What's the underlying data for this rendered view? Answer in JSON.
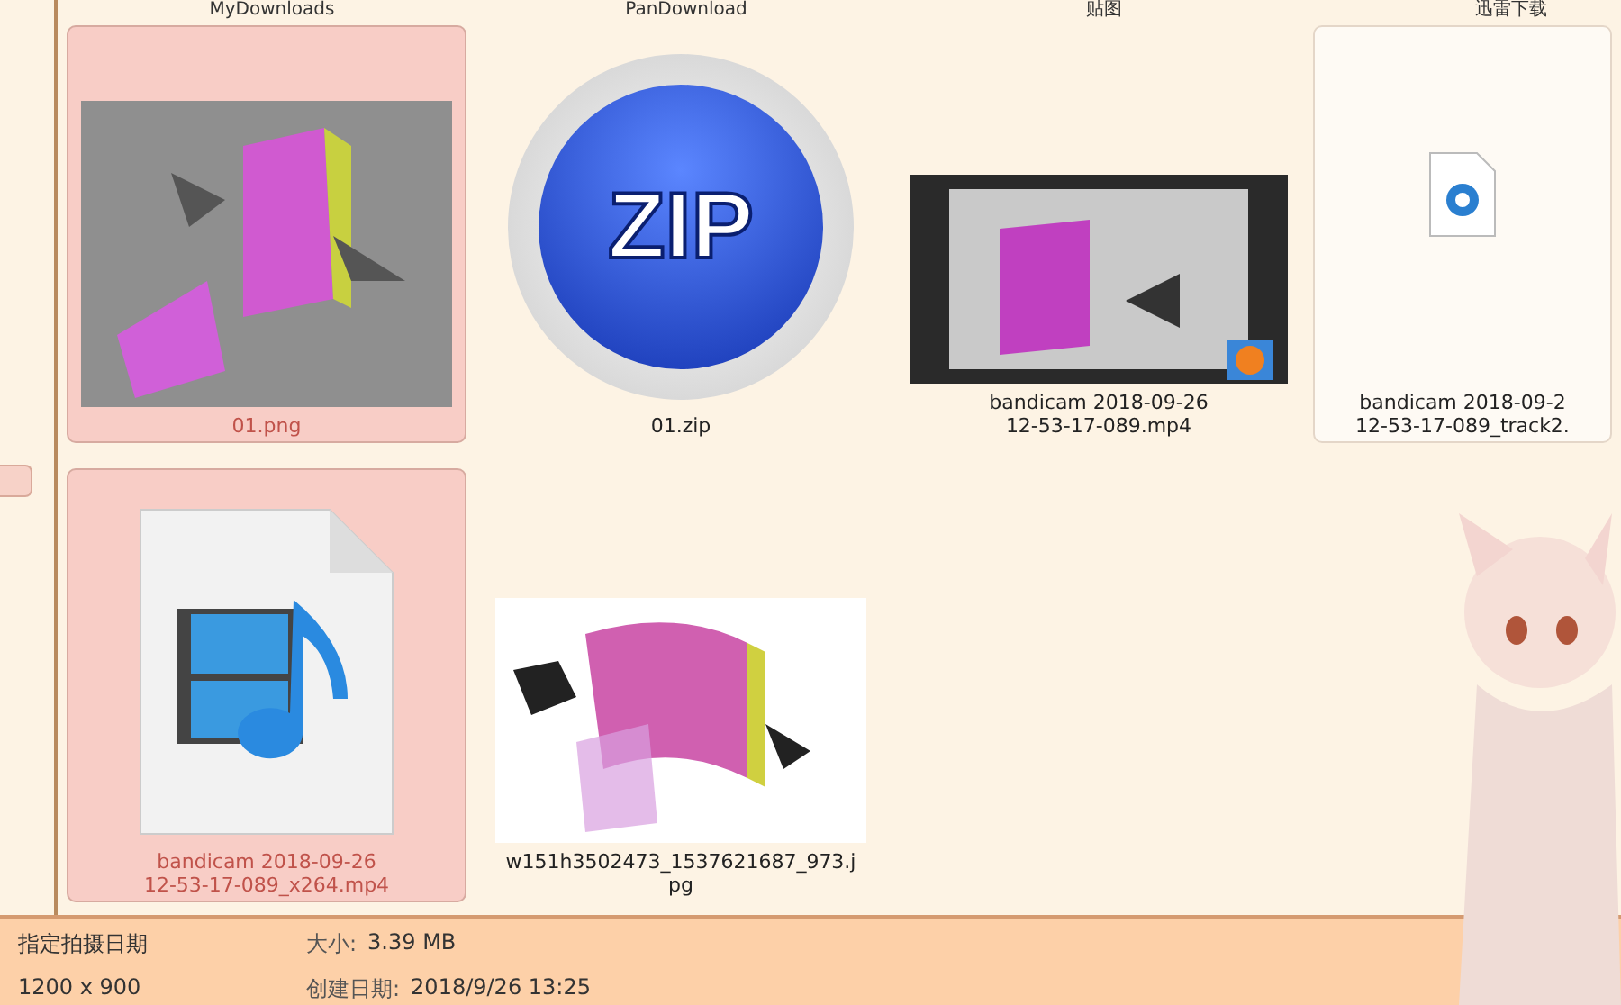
{
  "folders": [
    "MyDownloads",
    "PanDownload",
    "贴图",
    "迅雷下载"
  ],
  "items": [
    {
      "kind": "render-thumb",
      "name_lines": [
        "01.png"
      ],
      "selected": true
    },
    {
      "kind": "zip-icon",
      "icon_text": "ZIP",
      "name_lines": [
        "01.zip"
      ],
      "selected": false
    },
    {
      "kind": "video-thumb",
      "name_lines": [
        "bandicam 2018-09-26",
        "12-53-17-089.mp4"
      ],
      "selected": false
    },
    {
      "kind": "file-icon",
      "name_lines": [
        "bandicam 2018-09-2",
        "12-53-17-089_track2."
      ],
      "selected": false
    },
    {
      "kind": "media-icon",
      "name_lines": [
        "bandicam 2018-09-26",
        "12-53-17-089_x264.mp4"
      ],
      "selected": true
    },
    {
      "kind": "diagram-thumb",
      "name_lines": [
        "w151h3502473_1537621687_973.j",
        "pg"
      ],
      "selected": false
    }
  ],
  "details": [
    {
      "value": "指定拍摄日期"
    },
    {
      "label": "大小:",
      "value": "3.39 MB"
    },
    {
      "value": "1200 x 900"
    },
    {
      "label": "创建日期:",
      "value": "2018/9/26 13:25"
    }
  ]
}
